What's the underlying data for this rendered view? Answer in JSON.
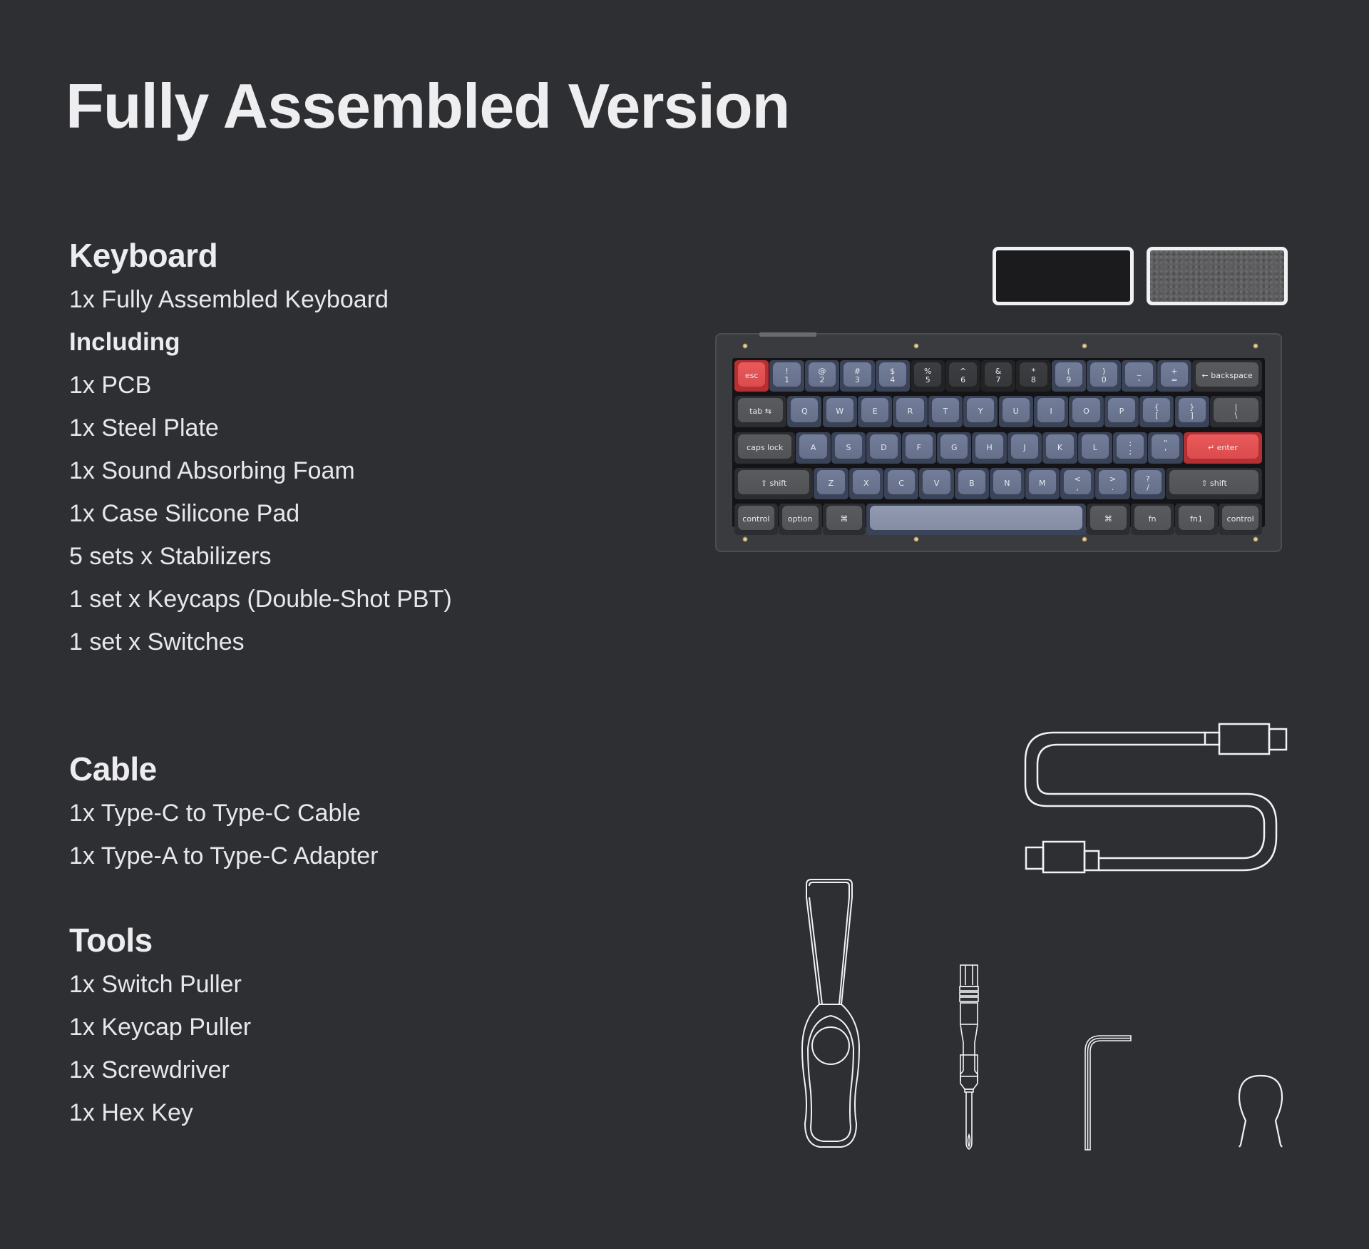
{
  "page": {
    "title": "Fully Assembled Version",
    "background_color": "#2e2f33",
    "text_color": "#ececee"
  },
  "sections": {
    "keyboard": {
      "heading": "Keyboard",
      "items": [
        "1x Fully Assembled Keyboard"
      ],
      "subheading": "Including",
      "included": [
        "1x PCB",
        "1x Steel Plate",
        "1x Sound Absorbing Foam",
        "1x Case Silicone Pad",
        "5 sets x Stabilizers",
        "1 set x Keycaps (Double-Shot PBT)",
        "1 set x Switches"
      ]
    },
    "cable": {
      "heading": "Cable",
      "items": [
        "1x Type-C to Type-C Cable",
        "1x Type-A to Type-C Adapter"
      ]
    },
    "tools": {
      "heading": "Tools",
      "items": [
        "1x Switch Puller",
        "1x Keycap Puller",
        "1x Screwdriver",
        "1x Hex Key"
      ]
    }
  },
  "swatches": [
    {
      "name": "black",
      "color": "#1b1b1d"
    },
    {
      "name": "grey-felt",
      "color": "#5e5e60"
    }
  ],
  "keyboard_image": {
    "accent_color": "#e2504f",
    "blue_keycap_color": "#6c7690",
    "dark_keycap_color": "#3a3b3e",
    "modifier_keycap_color": "#56575a",
    "rows": [
      [
        {
          "label": "esc",
          "style": "red",
          "w": 1
        },
        {
          "label": "!\n1",
          "style": "blue",
          "w": 1
        },
        {
          "label": "@\n2",
          "style": "blue",
          "w": 1
        },
        {
          "label": "#\n3",
          "style": "blue",
          "w": 1
        },
        {
          "label": "$\n4",
          "style": "blue",
          "w": 1
        },
        {
          "label": "%\n5",
          "style": "dark",
          "w": 1
        },
        {
          "label": "^\n6",
          "style": "dark",
          "w": 1
        },
        {
          "label": "&\n7",
          "style": "dark",
          "w": 1
        },
        {
          "label": "*\n8",
          "style": "dark",
          "w": 1
        },
        {
          "label": "(\n9",
          "style": "blue",
          "w": 1
        },
        {
          "label": ")\n0",
          "style": "blue",
          "w": 1
        },
        {
          "label": "_\n-",
          "style": "blue",
          "w": 1
        },
        {
          "label": "+\n=",
          "style": "blue",
          "w": 1
        },
        {
          "label": "← backspace",
          "style": "grey",
          "w": 2
        }
      ],
      [
        {
          "label": "tab ⇆",
          "style": "grey",
          "w": 1.5
        },
        {
          "label": "Q",
          "style": "blue",
          "w": 1
        },
        {
          "label": "W",
          "style": "blue",
          "w": 1
        },
        {
          "label": "E",
          "style": "blue",
          "w": 1
        },
        {
          "label": "R",
          "style": "blue",
          "w": 1
        },
        {
          "label": "T",
          "style": "blue",
          "w": 1
        },
        {
          "label": "Y",
          "style": "blue",
          "w": 1
        },
        {
          "label": "U",
          "style": "blue",
          "w": 1
        },
        {
          "label": "I",
          "style": "blue",
          "w": 1
        },
        {
          "label": "O",
          "style": "blue",
          "w": 1
        },
        {
          "label": "P",
          "style": "blue",
          "w": 1
        },
        {
          "label": "{\n[",
          "style": "blue",
          "w": 1
        },
        {
          "label": "}\n]",
          "style": "blue",
          "w": 1
        },
        {
          "label": "|\n\\",
          "style": "grey",
          "w": 1.5
        }
      ],
      [
        {
          "label": "caps lock",
          "style": "grey",
          "w": 1.75
        },
        {
          "label": "A",
          "style": "blue",
          "w": 1
        },
        {
          "label": "S",
          "style": "blue",
          "w": 1
        },
        {
          "label": "D",
          "style": "blue",
          "w": 1
        },
        {
          "label": "F",
          "style": "blue",
          "w": 1
        },
        {
          "label": "G",
          "style": "blue",
          "w": 1
        },
        {
          "label": "H",
          "style": "blue",
          "w": 1
        },
        {
          "label": "J",
          "style": "blue",
          "w": 1
        },
        {
          "label": "K",
          "style": "blue",
          "w": 1
        },
        {
          "label": "L",
          "style": "blue",
          "w": 1
        },
        {
          "label": ":\n;",
          "style": "blue",
          "w": 1
        },
        {
          "label": "\"\n'",
          "style": "blue",
          "w": 1
        },
        {
          "label": "↵ enter",
          "style": "red",
          "w": 2.25
        }
      ],
      [
        {
          "label": "⇧ shift",
          "style": "grey",
          "w": 2.25
        },
        {
          "label": "Z",
          "style": "blue",
          "w": 1
        },
        {
          "label": "X",
          "style": "blue",
          "w": 1
        },
        {
          "label": "C",
          "style": "blue",
          "w": 1
        },
        {
          "label": "V",
          "style": "blue",
          "w": 1
        },
        {
          "label": "B",
          "style": "blue",
          "w": 1
        },
        {
          "label": "N",
          "style": "blue",
          "w": 1
        },
        {
          "label": "M",
          "style": "blue",
          "w": 1
        },
        {
          "label": "<\n,",
          "style": "blue",
          "w": 1
        },
        {
          "label": ">\n.",
          "style": "blue",
          "w": 1
        },
        {
          "label": "?\n/",
          "style": "blue",
          "w": 1
        },
        {
          "label": "⇧ shift",
          "style": "grey",
          "w": 2.75
        }
      ],
      [
        {
          "label": "control",
          "style": "grey",
          "w": 1.25
        },
        {
          "label": "option",
          "style": "grey",
          "w": 1.25
        },
        {
          "label": "⌘",
          "style": "grey",
          "w": 1.25
        },
        {
          "label": "",
          "style": "space",
          "w": 6.25
        },
        {
          "label": "⌘",
          "style": "grey",
          "w": 1.25
        },
        {
          "label": "fn",
          "style": "grey",
          "w": 1.25
        },
        {
          "label": "fn1",
          "style": "grey",
          "w": 1.25
        },
        {
          "label": "control",
          "style": "grey",
          "w": 1.25
        }
      ]
    ]
  },
  "illustrations": [
    {
      "name": "type-c-cable",
      "icon": "cable-icon"
    },
    {
      "name": "switch-puller",
      "icon": "switch-puller-icon"
    },
    {
      "name": "screwdriver",
      "icon": "screwdriver-icon"
    },
    {
      "name": "hex-key",
      "icon": "hex-key-icon"
    },
    {
      "name": "keycap-puller",
      "icon": "keycap-puller-icon"
    }
  ]
}
